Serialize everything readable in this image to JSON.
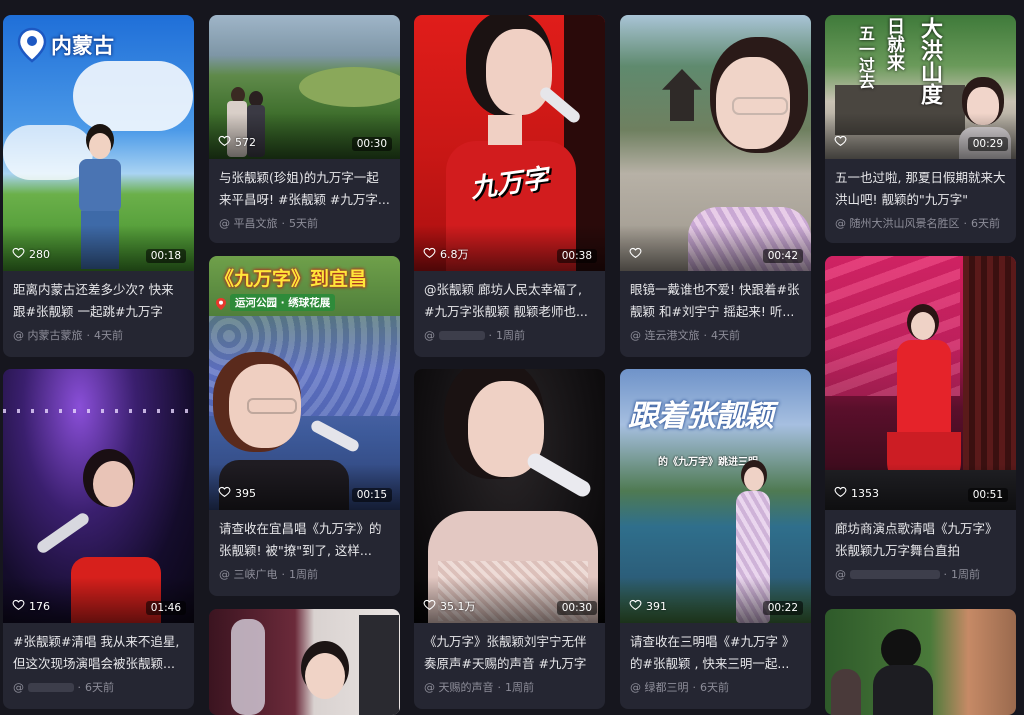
{
  "cards": [
    {
      "id": "c1",
      "overlay": {
        "badge": "内蒙古"
      },
      "likes": "280",
      "duration": "00:18",
      "title": "距离内蒙古还差多少次? 快来跟#张靓颖 一起跳#九万字 #...",
      "author": "内蒙古蒙旅",
      "time": "4天前"
    },
    {
      "id": "c2",
      "likes": "572",
      "duration": "00:30",
      "title": "与张靓颖(珍姐)的九万字一起来平昌呀! #张靓颖 #九万字...",
      "author": "平昌文旅",
      "time": "5天前"
    },
    {
      "id": "c3",
      "overlay": {
        "text": "九万字"
      },
      "likes": "6.8万",
      "duration": "00:38",
      "title": "@张靓颖 廊坊人民太幸福了, #九万字张靓颖 靓颖老师也...",
      "author": "",
      "author_blurred": true,
      "time": "1周前"
    },
    {
      "id": "c4",
      "likes": "",
      "duration": "00:42",
      "title": "眼镜一戴谁也不爱! 快跟着#张靓颖 和#刘宇宁 摇起来! 听...",
      "author": "连云港文旅",
      "time": "4天前"
    },
    {
      "id": "c5",
      "overlay": {
        "text1": "五一过去",
        "text2": "日就来",
        "text3": "大洪山度"
      },
      "likes": "",
      "duration": "00:29",
      "title": "五一也过啦, 那夏日假期就来大洪山吧! 靓颖的\"九万字\"",
      "author": "随州大洪山风景名胜区",
      "time": "6天前"
    },
    {
      "id": "c6",
      "overlay": {
        "title": "《九万字》到宜昌",
        "sub": "运河公园 · 绣球花展"
      },
      "likes": "395",
      "duration": "00:15",
      "title": "请查收在宜昌唱《九万字》的张靓颖! 被\"撩\"到了, 这样...",
      "author": "三峡广电",
      "time": "1周前"
    },
    {
      "id": "c7",
      "likes": "176",
      "duration": "01:46",
      "title": "#张靓颖#清唱 我从来不追星, 但这次现场演唱会被张靓颖...",
      "author": "",
      "author_blurred": true,
      "time": "6天前"
    },
    {
      "id": "c8",
      "likes": "35.1万",
      "duration": "00:30",
      "title": "《九万字》张靓颖刘宇宁无伴奏原声#天赐的声音 #九万字",
      "author": "天赐的声音",
      "time": "1周前"
    },
    {
      "id": "c9",
      "overlay": {
        "title": "跟着张靓颖",
        "sub": "的《九万字》跳进三明"
      },
      "likes": "391",
      "duration": "00:22",
      "title": "请查收在三明唱《#九万字 》的#张靓颖 , 快来三明一起...",
      "author": "绿都三明",
      "time": "6天前"
    },
    {
      "id": "c10",
      "likes": "1353",
      "duration": "00:51",
      "title": "廊坊商演点歌清唱《九万字》张靓颖九万字舞台直拍",
      "author": "",
      "author_blurred": true,
      "time": "1周前"
    },
    {
      "id": "c11"
    },
    {
      "id": "c12"
    }
  ],
  "colors": {
    "page_bg": "#16161e",
    "card_bg": "#252632",
    "title_text": "#e7e7ea",
    "meta_text": "#8d8d99"
  },
  "icons": [
    "heart-outline-icon"
  ]
}
